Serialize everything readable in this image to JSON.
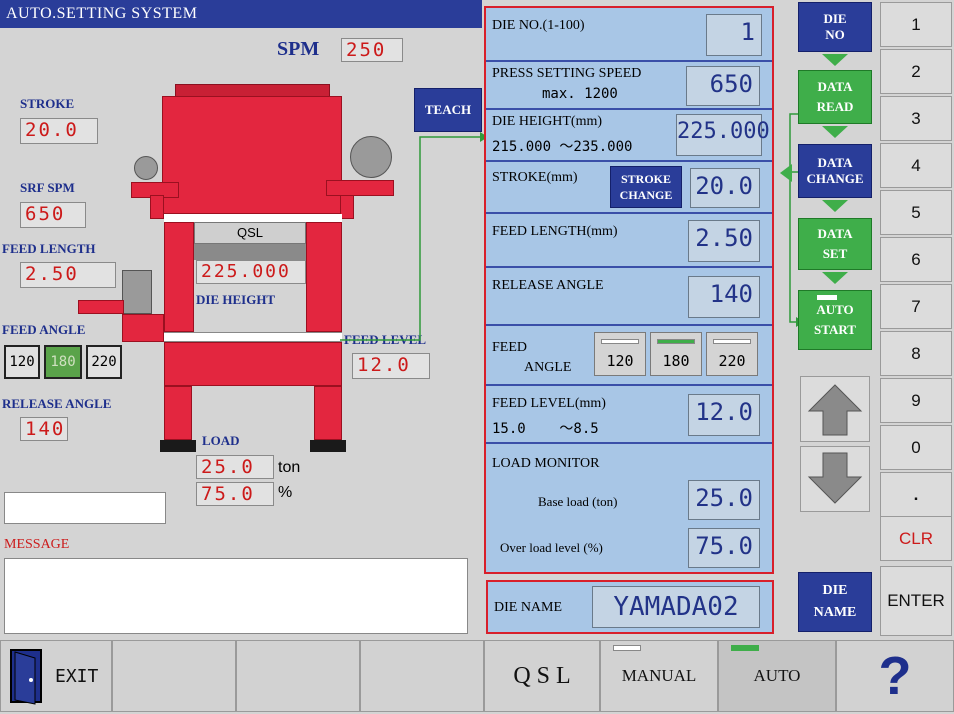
{
  "title": "AUTO.SETTING SYSTEM",
  "spm": {
    "label": "SPM",
    "value": "250"
  },
  "left": {
    "stroke": {
      "label": "STROKE",
      "value": "20.0"
    },
    "srf_spm": {
      "label": "SRF SPM",
      "value": "650"
    },
    "feed_length": {
      "label": "FEED LENGTH",
      "value": "2.50"
    },
    "feed_angle": {
      "label": "FEED ANGLE",
      "options": [
        "120",
        "180",
        "220"
      ],
      "selected": "180"
    },
    "release_angle": {
      "label": "RELEASE ANGLE",
      "value": "140"
    },
    "qsl": "QSL",
    "die_height": {
      "label": "DIE HEIGHT",
      "value": "225.000"
    },
    "feed_level": {
      "label": "FEED LEVEL",
      "value": "12.0"
    },
    "load": {
      "label": "LOAD",
      "ton_value": "25.0",
      "ton_unit": "ton",
      "pct_value": "75.0",
      "pct_unit": "%"
    },
    "teach": "TEACH",
    "message_label": "MESSAGE"
  },
  "panel": {
    "die_no": {
      "label": "DIE NO.(1-100)",
      "value": "1"
    },
    "press_speed": {
      "label": "PRESS SETTING SPEED",
      "sub": "max. 1200",
      "value": "650"
    },
    "die_height": {
      "label": "DIE HEIGHT(mm)",
      "sub": "215.000 ～235.000",
      "value": "225.000"
    },
    "stroke": {
      "label": "STROKE(mm)",
      "btn_line1": "STROKE",
      "btn_line2": "CHANGE",
      "value": "20.0"
    },
    "feed_length": {
      "label": "FEED LENGTH(mm)",
      "value": "2.50"
    },
    "release_angle": {
      "label": "RELEASE ANGLE",
      "value": "140"
    },
    "feed_angle": {
      "label1": "FEED",
      "label2": "ANGLE",
      "options": [
        "120",
        "180",
        "220"
      ],
      "selected": "180"
    },
    "feed_level": {
      "label": "FEED LEVEL(mm)",
      "sub": "15.0    ～8.5",
      "value": "12.0"
    },
    "load_monitor": {
      "label": "LOAD MONITOR",
      "base_label": "Base load (ton)",
      "base_value": "25.0",
      "over_label": "Over load level (%)",
      "over_value": "75.0"
    }
  },
  "die_name": {
    "label": "DIE NAME",
    "value": "YAMADA02"
  },
  "flow": {
    "die_no": [
      "DIE",
      "NO"
    ],
    "data_read": [
      "DATA",
      "READ"
    ],
    "data_change": [
      "DATA",
      "CHANGE"
    ],
    "data_set": [
      "DATA",
      "SET"
    ],
    "auto_start": [
      "AUTO",
      "START"
    ],
    "die_name": [
      "DIE",
      "NAME"
    ]
  },
  "keypad": [
    "1",
    "2",
    "3",
    "4",
    "5",
    "6",
    "7",
    "8",
    "9",
    "0",
    ".",
    "CLR",
    "ENTER"
  ],
  "bottom": {
    "exit": "EXIT",
    "qsl": "Q S L",
    "manual": "MANUAL",
    "auto": "AUTO",
    "help": "?"
  },
  "colors": {
    "accent_blue": "#2a3d99",
    "press_red": "#e3263f",
    "flow_green": "#3fae4a",
    "panel_blue": "#a8c6e6",
    "border_red": "#d81f2a"
  }
}
